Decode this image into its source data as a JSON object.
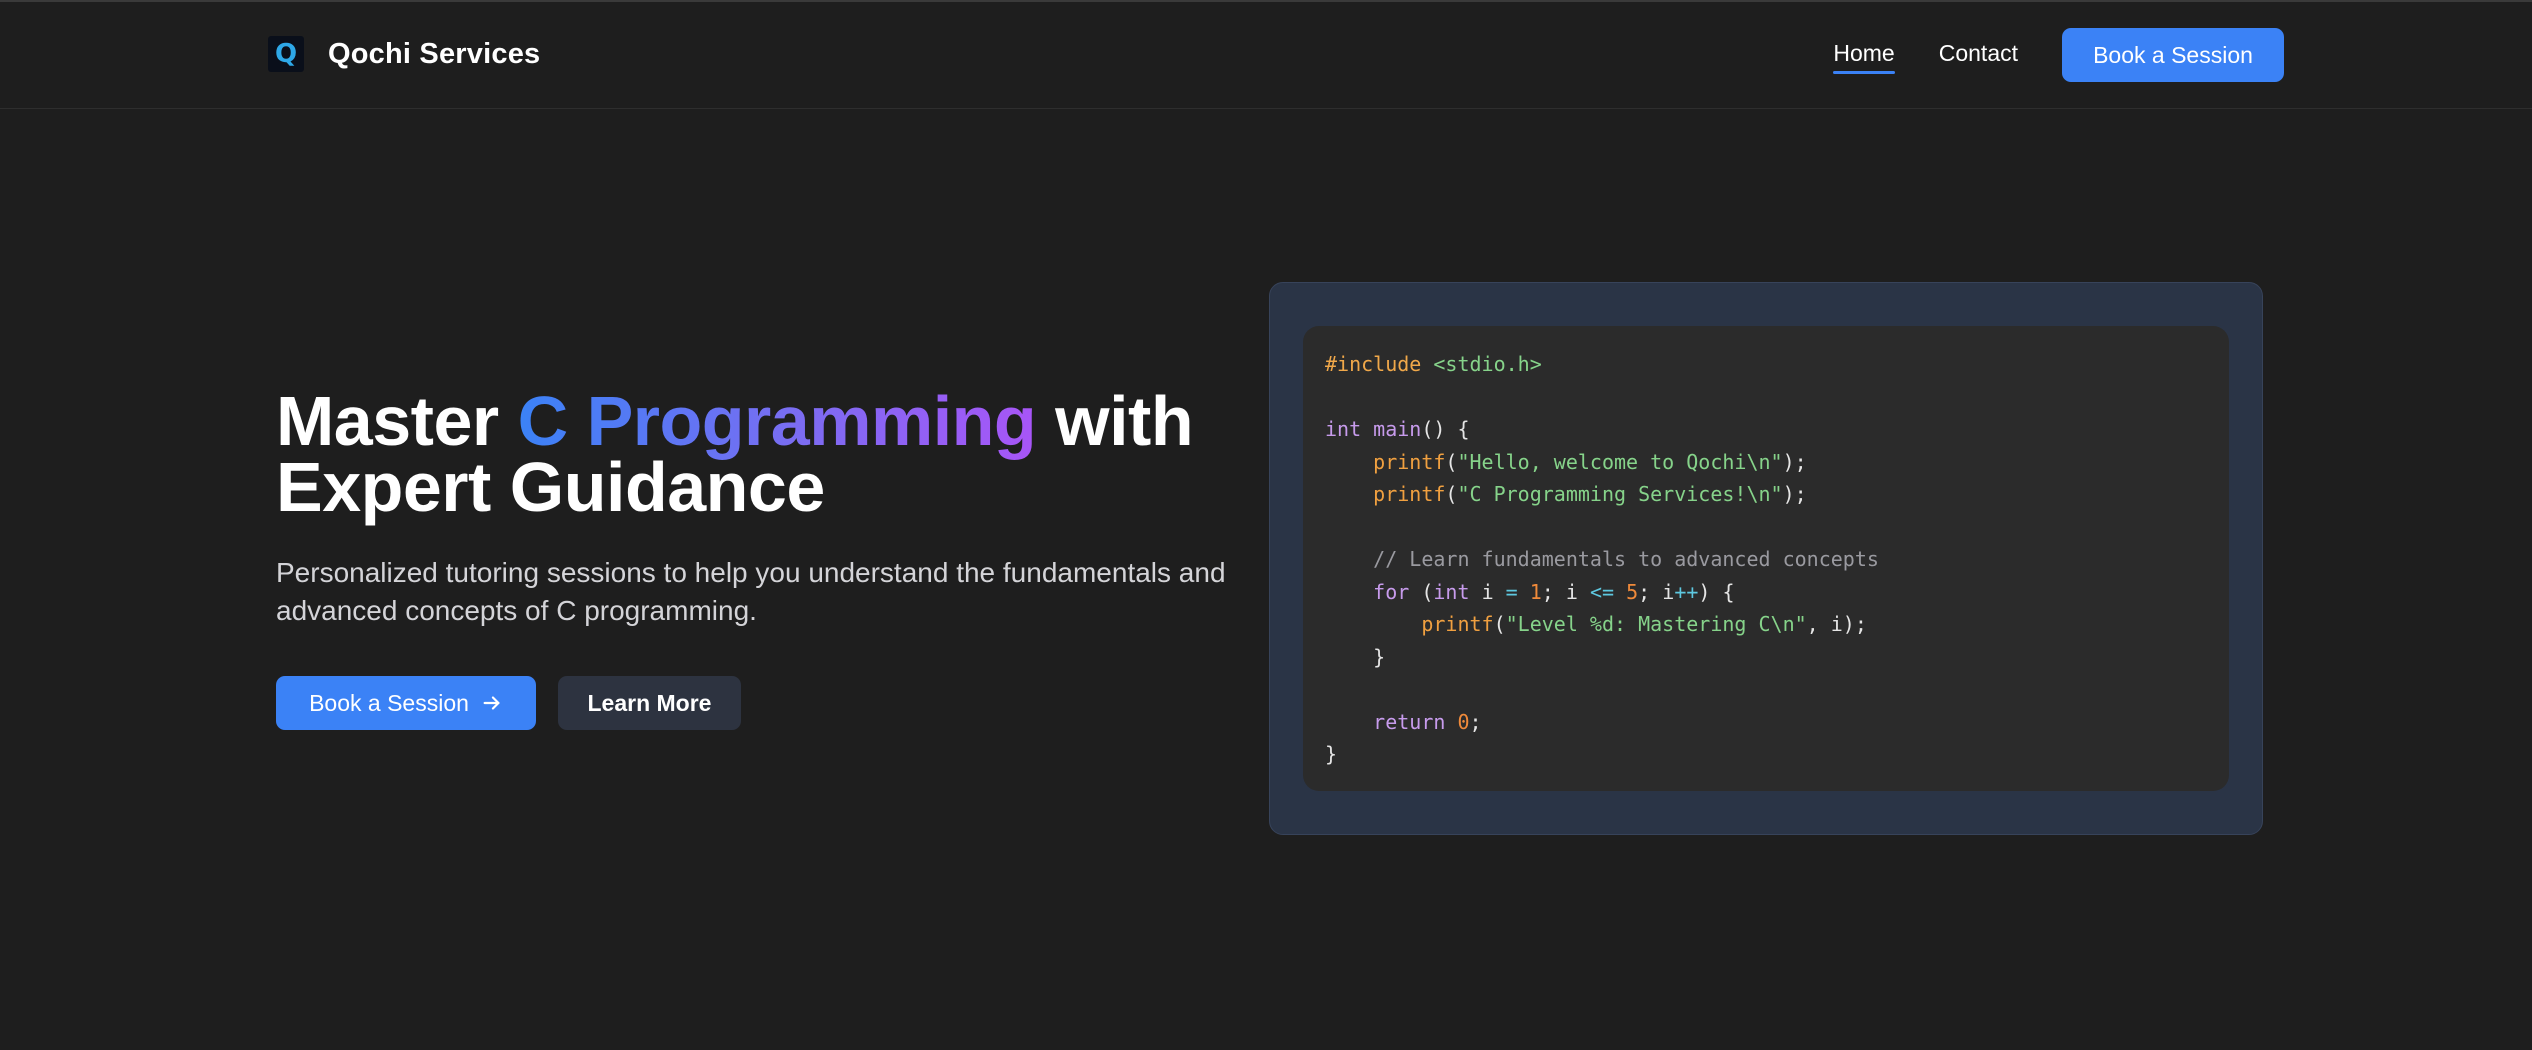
{
  "brand": {
    "logo_letter": "Q",
    "name": "Qochi Services"
  },
  "nav": {
    "links": [
      {
        "label": "Home",
        "active": true
      },
      {
        "label": "Contact",
        "active": false
      }
    ],
    "cta_label": "Book a Session"
  },
  "hero": {
    "title_part1": "Master ",
    "title_highlight": "C Programming",
    "title_part2": " with Expert Guidance",
    "subtitle": "Personalized tutoring sessions to help you understand the fundamentals and advanced concepts of C programming.",
    "primary_button": "Book a Session",
    "primary_button_icon": "arrow-right-icon",
    "secondary_button": "Learn More"
  },
  "code": {
    "include_directive": "#include",
    "include_header": "<stdio.h>",
    "kw_int": "int",
    "fn_main": "main",
    "fn_printf": "printf",
    "str_hello": "\"Hello, welcome to Qochi\\n\"",
    "str_services": "\"C Programming Services!\\n\"",
    "comment": "// Learn fundamentals to advanced concepts",
    "kw_for": "for",
    "var_i": "i",
    "num_start": "1",
    "num_end": "5",
    "str_level": "\"Level %d: Mastering C\\n\"",
    "kw_return": "return",
    "num_zero": "0"
  },
  "colors": {
    "background": "#1e1e1e",
    "accent": "#3b82f6",
    "gradient_end": "#a855f7",
    "code_panel": "#2a3446",
    "code_bg": "#2b2b2b"
  }
}
